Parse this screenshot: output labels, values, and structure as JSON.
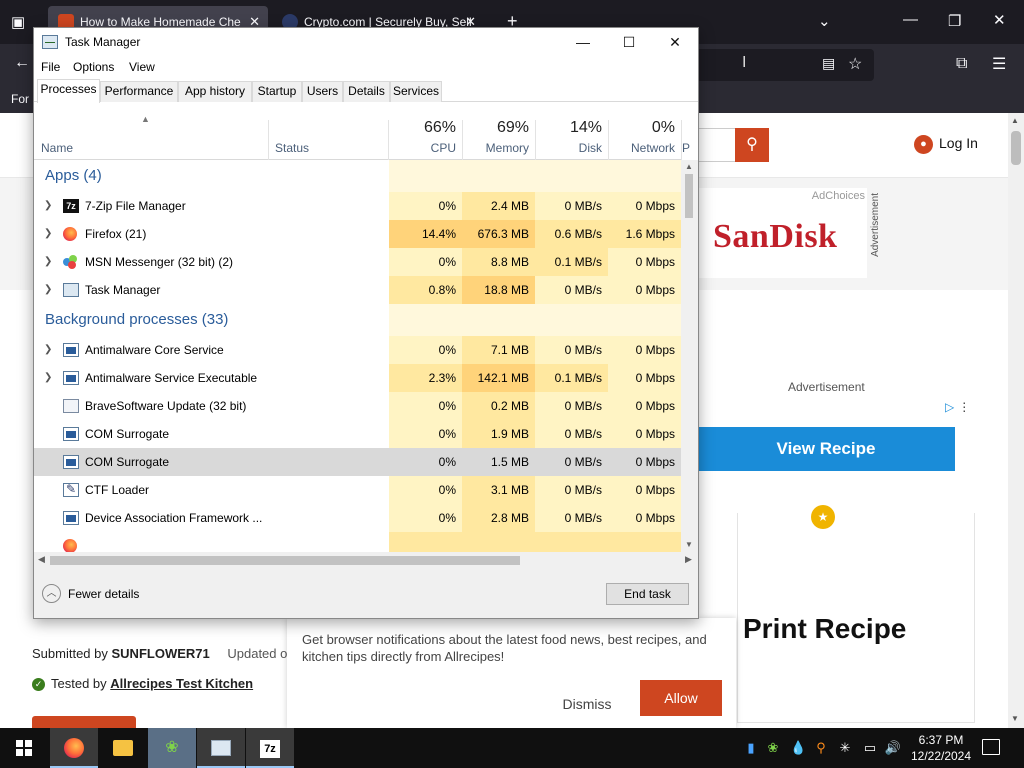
{
  "browser": {
    "tabs": [
      {
        "label": "How to Make Homemade Che",
        "active": true
      },
      {
        "label": "Crypto.com | Securely Buy, Sell",
        "active": false
      }
    ],
    "bookmarks_label": "For"
  },
  "webpage": {
    "login_label": "Log In",
    "ad": {
      "choices_label": "AdChoices",
      "brand": "SanDisk",
      "side_label": "Advertisement"
    },
    "advertisement_label": "Advertisement",
    "view_recipe_label": "View Recipe",
    "print_recipe_label": "Print Recipe",
    "submitted": {
      "prefix": "Submitted by",
      "author": "SUNFLOWER71",
      "updated": "Updated or"
    },
    "tested": {
      "prefix": "Tested by",
      "link": "Allrecipes Test Kitchen"
    },
    "notification": {
      "text": "Get browser notifications about the latest food news, best recipes, and kitchen tips directly from Allrecipes!",
      "dismiss_label": "Dismiss",
      "allow_label": "Allow"
    }
  },
  "task_manager": {
    "title": "Task Manager",
    "menu": [
      "File",
      "Options",
      "View"
    ],
    "tabs": [
      "Processes",
      "Performance",
      "App history",
      "Startup",
      "Users",
      "Details",
      "Services"
    ],
    "active_tab": "Processes",
    "columns": {
      "name": "Name",
      "status": "Status",
      "cpu": {
        "pct": "66%",
        "label": "CPU"
      },
      "memory": {
        "pct": "69%",
        "label": "Memory"
      },
      "disk": {
        "pct": "14%",
        "label": "Disk"
      },
      "network": {
        "pct": "0%",
        "label": "Network"
      },
      "power_partial": "P"
    },
    "groups": {
      "apps": "Apps (4)",
      "background": "Background processes (33)"
    },
    "apps": [
      {
        "name": "7-Zip File Manager",
        "cpu": "0%",
        "memory": "2.4 MB",
        "disk": "0 MB/s",
        "network": "0 Mbps",
        "expandable": true,
        "icon": "7zip-icon"
      },
      {
        "name": "Firefox (21)",
        "cpu": "14.4%",
        "memory": "676.3 MB",
        "disk": "0.6 MB/s",
        "network": "1.6 Mbps",
        "expandable": true,
        "icon": "firefox-icon"
      },
      {
        "name": "MSN Messenger (32 bit) (2)",
        "cpu": "0%",
        "memory": "8.8 MB",
        "disk": "0.1 MB/s",
        "network": "0 Mbps",
        "expandable": true,
        "icon": "msn-messenger-icon"
      },
      {
        "name": "Task Manager",
        "cpu": "0.8%",
        "memory": "18.8 MB",
        "disk": "0 MB/s",
        "network": "0 Mbps",
        "expandable": true,
        "icon": "task-manager-icon"
      }
    ],
    "background": [
      {
        "name": "Antimalware Core Service",
        "cpu": "0%",
        "memory": "7.1 MB",
        "disk": "0 MB/s",
        "network": "0 Mbps",
        "expandable": true,
        "icon": "service-icon"
      },
      {
        "name": "Antimalware Service Executable",
        "cpu": "2.3%",
        "memory": "142.1 MB",
        "disk": "0.1 MB/s",
        "network": "0 Mbps",
        "expandable": true,
        "icon": "service-icon"
      },
      {
        "name": "BraveSoftware Update (32 bit)",
        "cpu": "0%",
        "memory": "0.2 MB",
        "disk": "0 MB/s",
        "network": "0 Mbps",
        "expandable": false,
        "icon": "brave-update-icon"
      },
      {
        "name": "COM Surrogate",
        "cpu": "0%",
        "memory": "1.9 MB",
        "disk": "0 MB/s",
        "network": "0 Mbps",
        "expandable": false,
        "icon": "service-icon"
      },
      {
        "name": "COM Surrogate",
        "cpu": "0%",
        "memory": "1.5 MB",
        "disk": "0 MB/s",
        "network": "0 Mbps",
        "expandable": false,
        "icon": "service-icon",
        "selected": true
      },
      {
        "name": "CTF Loader",
        "cpu": "0%",
        "memory": "3.1 MB",
        "disk": "0 MB/s",
        "network": "0 Mbps",
        "expandable": false,
        "icon": "ctf-loader-icon"
      },
      {
        "name": "Device Association Framework ...",
        "cpu": "0%",
        "memory": "2.8 MB",
        "disk": "0 MB/s",
        "network": "0 Mbps",
        "expandable": false,
        "icon": "service-icon"
      }
    ],
    "footer": {
      "fewer_details": "Fewer details",
      "end_task": "End task"
    }
  },
  "taskbar": {
    "time": "6:37 PM",
    "date": "12/22/2024",
    "pinned": [
      "start",
      "firefox",
      "file-explorer",
      "msn-messenger",
      "task-manager",
      "7zip"
    ]
  },
  "colors": {
    "accent_orange": "#ce4620",
    "view_recipe_blue": "#1a8cd8",
    "tm_group_blue": "#2a5c9a",
    "heat_light": "#fff4c4",
    "heat_mid": "#ffe8a0",
    "heat_high": "#ffd37a"
  }
}
